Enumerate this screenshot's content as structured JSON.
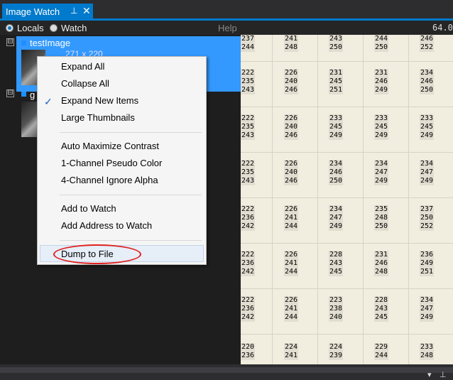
{
  "tab": {
    "title": "Image Watch",
    "pin": "⊥",
    "close": "✕"
  },
  "toolbar": {
    "radio_locals": "Locals",
    "radio_watch": "Watch",
    "help": "Help",
    "zoom": "64.0"
  },
  "tree": {
    "item1": {
      "name": "testImage",
      "dims": "271 x 220"
    },
    "item2": {
      "name": "g"
    },
    "expander": "⊟"
  },
  "menu": {
    "items": [
      "Expand All",
      "Collapse All",
      "Expand New Items",
      "Large Thumbnails",
      "Auto Maximize Contrast",
      "1-Channel Pseudo Color",
      "4-Channel Ignore Alpha",
      "Add to Watch",
      "Add Address to Watch",
      "Dump to File"
    ],
    "checked_item": "Expand New Items",
    "check_glyph": "✓"
  },
  "grid": {
    "rows": [
      [
        [
          "237",
          "244"
        ],
        [
          "241",
          "248"
        ],
        [
          "243",
          "250"
        ],
        [
          "244",
          "250"
        ],
        [
          "246",
          "252"
        ]
      ],
      [
        [
          "222",
          "235",
          "243"
        ],
        [
          "226",
          "240",
          "246"
        ],
        [
          "231",
          "245",
          "251"
        ],
        [
          "231",
          "246",
          "249"
        ],
        [
          "234",
          "246",
          "250"
        ]
      ],
      [
        [
          "222",
          "235",
          "243"
        ],
        [
          "226",
          "240",
          "246"
        ],
        [
          "233",
          "245",
          "249"
        ],
        [
          "233",
          "245",
          "249"
        ],
        [
          "233",
          "245",
          "249"
        ]
      ],
      [
        [
          "222",
          "235",
          "243"
        ],
        [
          "226",
          "240",
          "246"
        ],
        [
          "234",
          "246",
          "250"
        ],
        [
          "234",
          "247",
          "249"
        ],
        [
          "234",
          "247",
          "249"
        ]
      ],
      [
        [
          "222",
          "236",
          "242"
        ],
        [
          "226",
          "241",
          "244"
        ],
        [
          "234",
          "247",
          "249"
        ],
        [
          "235",
          "248",
          "250"
        ],
        [
          "237",
          "250",
          "252"
        ]
      ],
      [
        [
          "222",
          "236",
          "242"
        ],
        [
          "226",
          "241",
          "244"
        ],
        [
          "228",
          "243",
          "245"
        ],
        [
          "231",
          "246",
          "248"
        ],
        [
          "236",
          "249",
          "251"
        ]
      ],
      [
        [
          "222",
          "236",
          "242"
        ],
        [
          "226",
          "241",
          "244"
        ],
        [
          "223",
          "238",
          "240"
        ],
        [
          "228",
          "243",
          "245"
        ],
        [
          "234",
          "247",
          "249"
        ]
      ],
      [
        [
          "220",
          "236"
        ],
        [
          "224",
          "241"
        ],
        [
          "224",
          "239"
        ],
        [
          "229",
          "244"
        ],
        [
          "233",
          "248"
        ]
      ]
    ]
  },
  "bottom": {
    "dropdown": "▾",
    "pin": "⊥"
  },
  "colors": {
    "accent": "#007acc",
    "selection": "#3399ff",
    "annotation": "#e02020"
  }
}
